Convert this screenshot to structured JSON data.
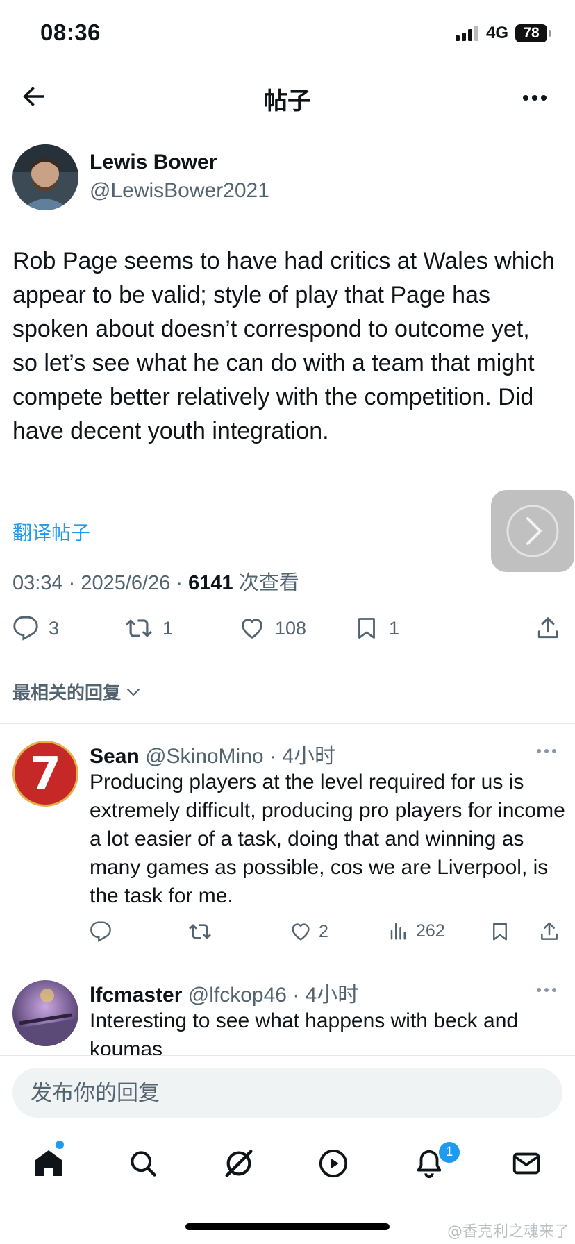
{
  "status_bar": {
    "time": "08:36",
    "network": "4G",
    "battery": "78"
  },
  "header": {
    "title": "帖子"
  },
  "post": {
    "author_name": "Lewis Bower",
    "author_handle": "@LewisBower2021",
    "text": "Rob Page seems to have had critics at Wales which appear to be valid; style of play that Page has spoken about doesn’t correspond to outcome yet, so let’s see what he can do with a team that might compete better relatively with the competition. Did have decent youth integration.",
    "translate_label": "翻译帖子",
    "time": "03:34",
    "date": "2025/6/26",
    "views": "6141",
    "views_label": "次查看",
    "replies": "3",
    "reposts": "1",
    "likes": "108",
    "bookmarks": "1"
  },
  "sort_label": "最相关的回复",
  "replies": [
    {
      "name": "Sean",
      "handle": "@SkinoMino",
      "time": "4小时",
      "avatar_text": "7",
      "text": "Producing players at the level required for us is extremely difficult, producing pro players for income a lot easier of a task,  doing that and winning as many games as possible, cos we are Liverpool, is the  task for me.",
      "likes": "2",
      "views": "262"
    },
    {
      "name": "lfcmaster",
      "handle": "@lfckop46",
      "time": "4小时",
      "text": "Interesting to see what happens with beck and koumas"
    }
  ],
  "composer": {
    "placeholder": "发布你的回复"
  },
  "tabbar": {
    "notifications_badge": "1"
  },
  "watermark": "@香克利之魂来了",
  "colors": {
    "accent": "#1d9bf0",
    "text": "#0f1419",
    "secondary": "#536471"
  }
}
